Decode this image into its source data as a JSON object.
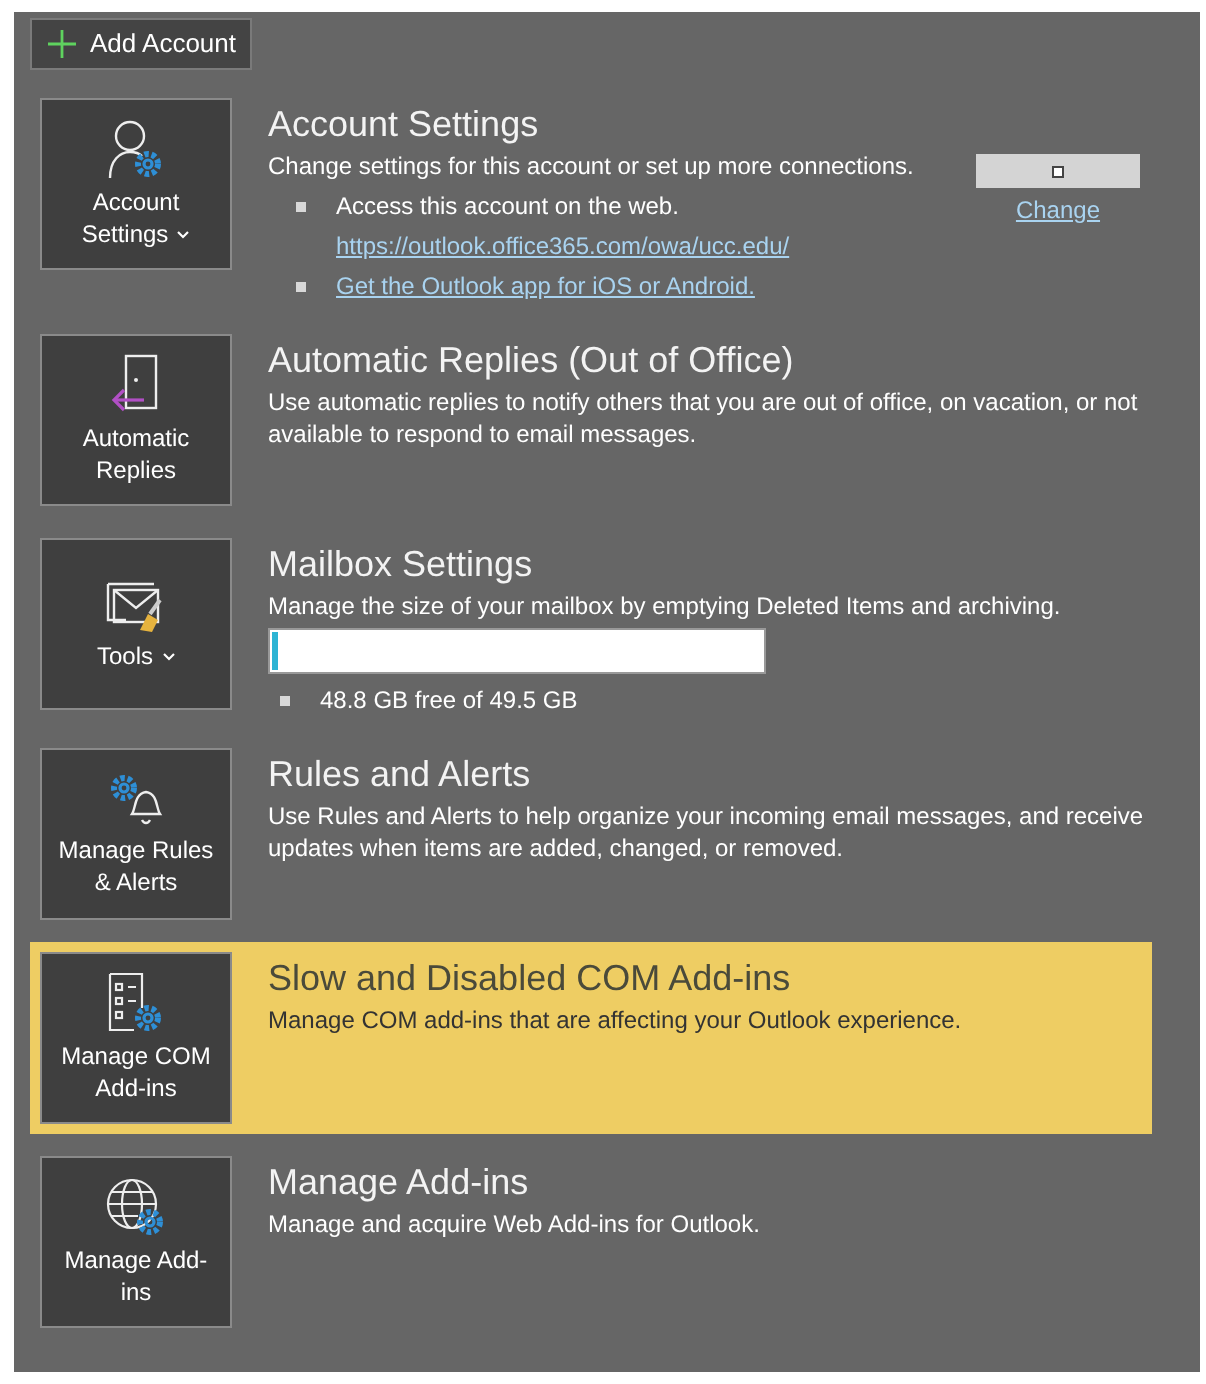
{
  "add_account": {
    "label": "Add Account"
  },
  "sections": [
    {
      "kind": "account",
      "selected": false,
      "tile": {
        "label": "Account Settings",
        "dropdown": true
      },
      "title": "Account Settings",
      "description": "Change settings for this account or set up more connections.",
      "lines": [
        {
          "kind": "text",
          "bullet": true,
          "text": "Access this account on the web."
        },
        {
          "kind": "link",
          "bullet": false,
          "text": "https://outlook.office365.com/owa/ucc.edu/"
        },
        {
          "kind": "link",
          "bullet": true,
          "text": "Get the Outlook app for iOS or Android."
        }
      ],
      "change_link": "Change"
    },
    {
      "kind": "plain",
      "selected": false,
      "tile": {
        "label": "Automatic Replies",
        "dropdown": false
      },
      "title": "Automatic Replies (Out of Office)",
      "description": "Use automatic replies to notify others that you are out of office, on vacation, or not available to respond to email messages."
    },
    {
      "kind": "mailbox",
      "selected": false,
      "tile": {
        "label": "Tools",
        "dropdown": true
      },
      "title": "Mailbox Settings",
      "description": "Manage the size of your mailbox by emptying Deleted Items and archiving.",
      "level": 0.014,
      "usage": "48.8 GB free of 49.5 GB"
    },
    {
      "kind": "plain",
      "selected": false,
      "tile": {
        "label": "Manage Rules & Alerts",
        "dropdown": false
      },
      "title": "Rules and Alerts",
      "description": "Use Rules and Alerts to help organize your incoming email messages, and receive updates when items are added, changed, or removed."
    },
    {
      "kind": "plain",
      "selected": true,
      "tile": {
        "label": "Manage COM Add-ins",
        "dropdown": false
      },
      "title": "Slow and Disabled COM Add-ins",
      "description": "Manage COM add-ins that are affecting your Outlook experience."
    },
    {
      "kind": "plain",
      "selected": false,
      "tile": {
        "label": "Manage Add-ins",
        "dropdown": false
      },
      "title": "Manage Add-ins",
      "description": "Manage and acquire Web Add-ins for Outlook."
    }
  ]
}
